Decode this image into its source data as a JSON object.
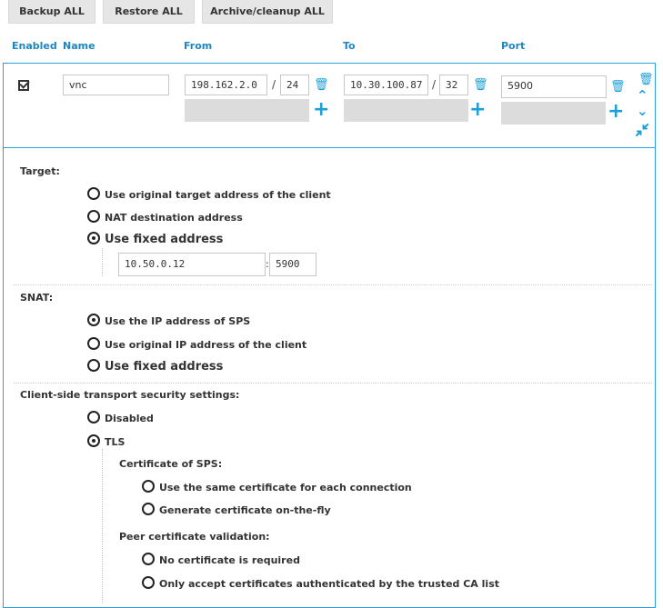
{
  "toolbar": {
    "backup_all": "Backup ALL",
    "restore_all": "Restore ALL",
    "archive_cleanup_all": "Archive/cleanup ALL"
  },
  "columns": {
    "enabled": "Enabled",
    "name": "Name",
    "from": "From",
    "to": "To",
    "port": "Port"
  },
  "row": {
    "enabled": true,
    "name": "vnc",
    "from_address": "198.162.2.0",
    "from_prefix": "24",
    "to_address": "10.30.100.87",
    "to_prefix": "32",
    "port": "5900"
  },
  "target": {
    "label": "Target:",
    "options": [
      "Use original target address of the client",
      "NAT destination address",
      "Use fixed address"
    ],
    "selected_index": 2,
    "fixed_address": "10.50.0.12",
    "fixed_port": "5900"
  },
  "snat": {
    "label": "SNAT:",
    "options": [
      "Use the IP address of SPS",
      "Use original IP address of the client",
      "Use fixed address"
    ],
    "selected_index": 0
  },
  "client_tls": {
    "label": "Client-side transport security settings:",
    "options": [
      "Disabled",
      "TLS"
    ],
    "selected_index": 1,
    "certificate_label": "Certificate of SPS:",
    "certificate_options": [
      "Use the same certificate for each connection",
      "Generate certificate on-the-fly"
    ],
    "peer_label": "Peer certificate validation:",
    "peer_options": [
      "No certificate is required",
      "Only accept certificates authenticated by the trusted CA list"
    ]
  },
  "icons": {
    "delete": "trash-icon",
    "add": "plus-icon",
    "move_up": "chevron-up-icon",
    "move_down": "chevron-down-icon",
    "collapse": "collapse-icon"
  },
  "colors": {
    "accent": "#1d9fdb",
    "header_text": "#1d87bf",
    "toolbar_bg": "#e6e6e6"
  }
}
